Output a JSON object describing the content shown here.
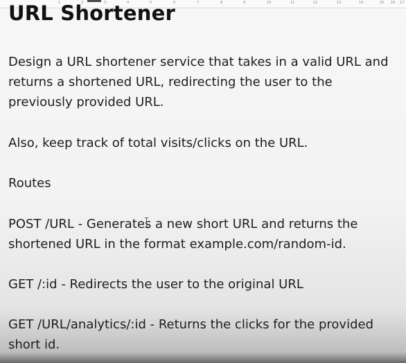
{
  "ruler": {
    "numbers": [
      "1",
      "2",
      "3",
      "4",
      "5",
      "6",
      "7",
      "8",
      "9",
      "10",
      "11",
      "12",
      "13",
      "14",
      "15",
      "16",
      "17"
    ]
  },
  "document": {
    "title": "URL Shortener",
    "paragraphs": [
      "Design a URL shortener service that takes in a valid URL and",
      "returns a shortened URL, redirecting the user to the",
      "previously provided URL.",
      "Also, keep track of total visits/clicks on the URL.",
      "Routes",
      "POST /URL - Generates a new short URL and returns the",
      "shortened URL in the format example.com/random-id.",
      "GET /:id - Redirects the user to the original URL",
      "GET /URL/analytics/:id - Returns the clicks for the provided",
      "short id."
    ]
  }
}
